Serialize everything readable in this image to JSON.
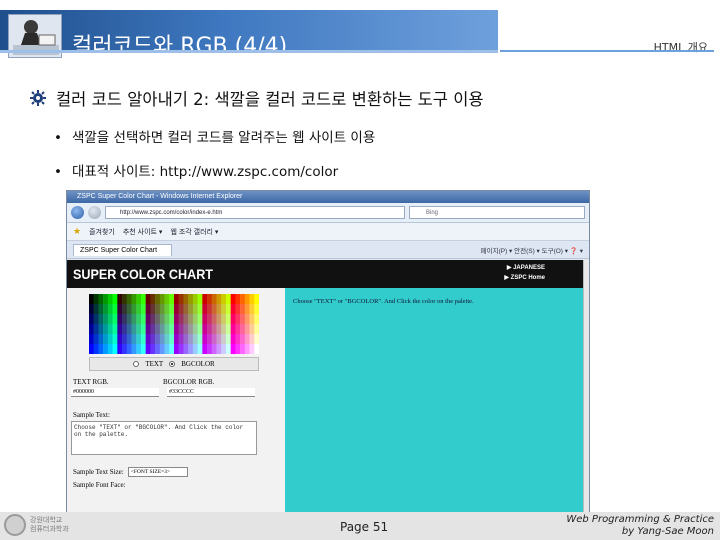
{
  "slide": {
    "title": "컬러코드와 RGB (4/4)",
    "header_right": "HTML 개요",
    "main_bullet": "컬러 코드 알아내기 2: 색깔을 컬러 코드로 변환하는 도구 이용",
    "sub_bullets": [
      "색깔을 선택하면 컬러 코드를 알려주는 웹 사이트 이용",
      "대표적 사이트: http://www.zspc.com/color"
    ]
  },
  "browser": {
    "window_title": "ZSPC Super Color Chart - Windows Internet Explorer",
    "url": "http://www.zspc.com/color/index-e.htm",
    "search_placeholder": "Bing",
    "favorites_label": "즐겨찾기",
    "favorites_items": [
      "추천 사이트 ▾",
      "웹 조각 갤러리 ▾"
    ],
    "tab_label": "ZSPC Super Color Chart",
    "toolbar_text": "페이지(P) ▾  안전(S) ▾  도구(O) ▾  ❓ ▾",
    "page": {
      "banner_title": "SUPER COLOR CHART",
      "links": [
        "JAPANESE",
        "ZSPC Home"
      ],
      "radio_text": "TEXT",
      "radio_bgcolor": "BGCOLOR",
      "text_rgb_label": "TEXT RGB.",
      "bgcolor_rgb_label": "BGCOLOR RGB.",
      "text_rgb_value": "#000000",
      "bgcolor_rgb_value": "#33CCCC",
      "sample_text_label": "Sample Text:",
      "sample_text_value": "Choose \"TEXT\" or \"BGCOLOR\". And Click the color on the palette.",
      "sample_size_label": "Sample Text Size:",
      "sample_size_value": "<FONT SIZE=3>",
      "sample_face_label": "Sample Font Face:",
      "instruction": "Choose \"TEXT\" or \"BGCOLOR\". And Click the color on the palette.",
      "selected_bgcolor": "#33cccc"
    }
  },
  "footer": {
    "page_number": "Page 51",
    "credit_line1": "Web Programming & Practice",
    "credit_line2": "by Yang-Sae Moon",
    "logo_line1": "강원대학교",
    "logo_line2": "컴퓨터과학과"
  },
  "colors": {
    "title_gradient_start": "#1f4f8c",
    "title_gradient_end": "#6ea0dc",
    "accent_cyan": "#33cccc"
  }
}
